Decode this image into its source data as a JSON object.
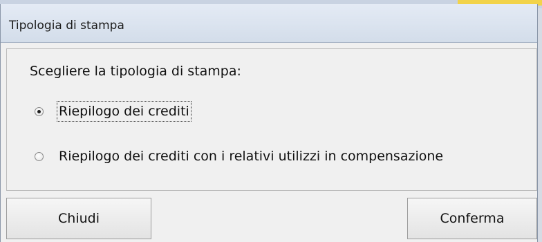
{
  "dialog": {
    "title": "Tipologia di stampa",
    "prompt": "Scegliere la tipologia di stampa:",
    "options": [
      {
        "label": "Riepilogo dei crediti",
        "selected": true
      },
      {
        "label": "Riepilogo dei crediti con i relativi utilizzi in compensazione",
        "selected": false
      }
    ],
    "buttons": {
      "close_label": "Chiudi",
      "confirm_label": "Conferma"
    }
  }
}
